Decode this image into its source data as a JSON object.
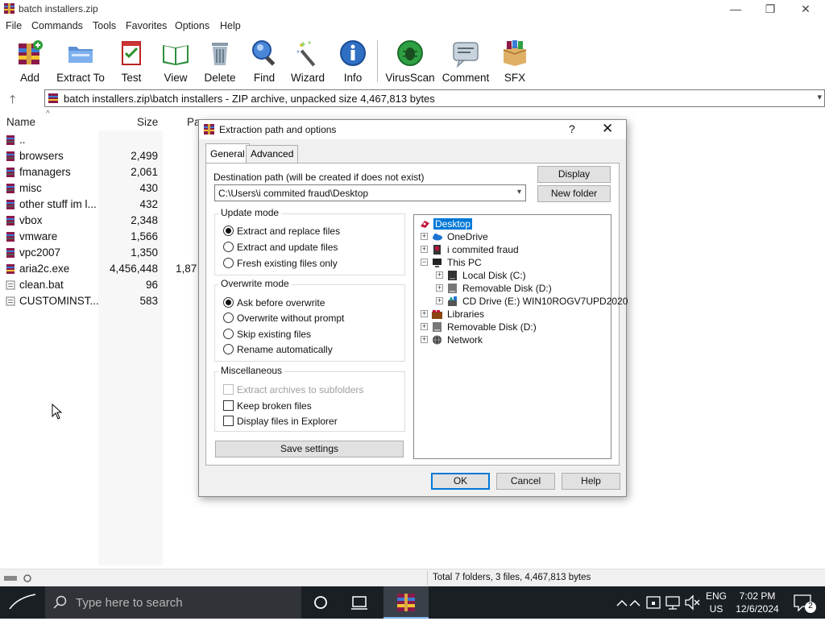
{
  "window": {
    "title": "batch installers.zip",
    "minimize_symbol": "—",
    "maximize_symbol": "❐",
    "close_symbol": "✕"
  },
  "menu": [
    "File",
    "Commands",
    "Tools",
    "Favorites",
    "Options",
    "Help"
  ],
  "toolbar": {
    "buttons": [
      {
        "label": "Add",
        "icon": "add-icon"
      },
      {
        "label": "Extract To",
        "icon": "extract-to-icon"
      },
      {
        "label": "Test",
        "icon": "test-icon"
      },
      {
        "label": "View",
        "icon": "view-icon"
      },
      {
        "label": "Delete",
        "icon": "delete-icon"
      },
      {
        "label": "Find",
        "icon": "find-icon"
      },
      {
        "label": "Wizard",
        "icon": "wizard-icon"
      },
      {
        "label": "Info",
        "icon": "info-icon"
      },
      {
        "label": "VirusScan",
        "icon": "virusscan-icon"
      },
      {
        "label": "Comment",
        "icon": "comment-icon"
      },
      {
        "label": "SFX",
        "icon": "sfx-icon"
      }
    ]
  },
  "address": {
    "up_symbol": "🡑",
    "path": "batch installers.zip\\batch installers - ZIP archive, unpacked size 4,467,813 bytes"
  },
  "filelist": {
    "columns": {
      "name": "Name",
      "size": "Size",
      "packed": "Pa",
      "sort_indicator": "^"
    },
    "rows": [
      {
        "name": "..",
        "size": "",
        "packed": "",
        "type": "folder"
      },
      {
        "name": "browsers",
        "size": "2,499",
        "packed": "",
        "type": "folder"
      },
      {
        "name": "fmanagers",
        "size": "2,061",
        "packed": "",
        "type": "folder"
      },
      {
        "name": "misc",
        "size": "430",
        "packed": "",
        "type": "folder"
      },
      {
        "name": "other stuff im l...",
        "size": "432",
        "packed": "",
        "type": "folder"
      },
      {
        "name": "vbox",
        "size": "2,348",
        "packed": "",
        "type": "folder"
      },
      {
        "name": "vmware",
        "size": "1,566",
        "packed": "",
        "type": "folder"
      },
      {
        "name": "vpc2007",
        "size": "1,350",
        "packed": "",
        "type": "folder"
      },
      {
        "name": "aria2c.exe",
        "size": "4,456,448",
        "packed": "1,87",
        "type": "exe"
      },
      {
        "name": "clean.bat",
        "size": "96",
        "packed": "",
        "type": "bat"
      },
      {
        "name": "CUSTOMINST...",
        "size": "583",
        "packed": "",
        "type": "bat"
      }
    ]
  },
  "status": {
    "text": "Total 7 folders, 3 files, 4,467,813 bytes"
  },
  "dialog": {
    "title": "Extraction path and options",
    "help_symbol": "?",
    "close_symbol": "✕",
    "tabs": [
      "General",
      "Advanced"
    ],
    "destination_label": "Destination path (will be created if does not exist)",
    "destination_value": "C:\\Users\\i commited fraud\\Desktop",
    "display_button": "Display",
    "new_folder_button": "New folder",
    "update_mode": {
      "title": "Update mode",
      "options": [
        "Extract and replace files",
        "Extract and update files",
        "Fresh existing files only"
      ],
      "selected": 0
    },
    "overwrite_mode": {
      "title": "Overwrite mode",
      "options": [
        "Ask before overwrite",
        "Overwrite without prompt",
        "Skip existing files",
        "Rename automatically"
      ],
      "selected": 0
    },
    "misc": {
      "title": "Miscellaneous",
      "options": [
        {
          "label": "Extract archives to subfolders",
          "checked": false,
          "disabled": true
        },
        {
          "label": "Keep broken files",
          "checked": false,
          "disabled": false
        },
        {
          "label": "Display files in Explorer",
          "checked": false,
          "disabled": false
        }
      ]
    },
    "save_settings_button": "Save settings",
    "tree": [
      {
        "label": "Desktop",
        "selected": true,
        "icon": "desktop-icon"
      },
      {
        "label": "OneDrive",
        "icon": "onedrive-icon"
      },
      {
        "label": "i commited fraud",
        "icon": "user-folder-icon"
      },
      {
        "label": "This PC",
        "icon": "this-pc-icon"
      },
      {
        "label": "Local Disk (C:)",
        "icon": "local-disk-icon"
      },
      {
        "label": "Removable Disk (D:)",
        "icon": "removable-disk-icon"
      },
      {
        "label": "CD Drive (E:) WIN10ROGV7UPD2020",
        "icon": "cd-drive-icon"
      },
      {
        "label": "Libraries",
        "icon": "libraries-icon"
      },
      {
        "label": "Removable Disk (D:)",
        "icon": "removable-disk-icon"
      },
      {
        "label": "Network",
        "icon": "network-icon"
      }
    ],
    "ok_button": "OK",
    "cancel_button": "Cancel",
    "help_button": "Help"
  },
  "taskbar": {
    "search_placeholder": "Type here to search",
    "language": "ENG",
    "locale": "US",
    "time": "7:02 PM",
    "date": "12/6/2024",
    "notification_count": "2"
  }
}
